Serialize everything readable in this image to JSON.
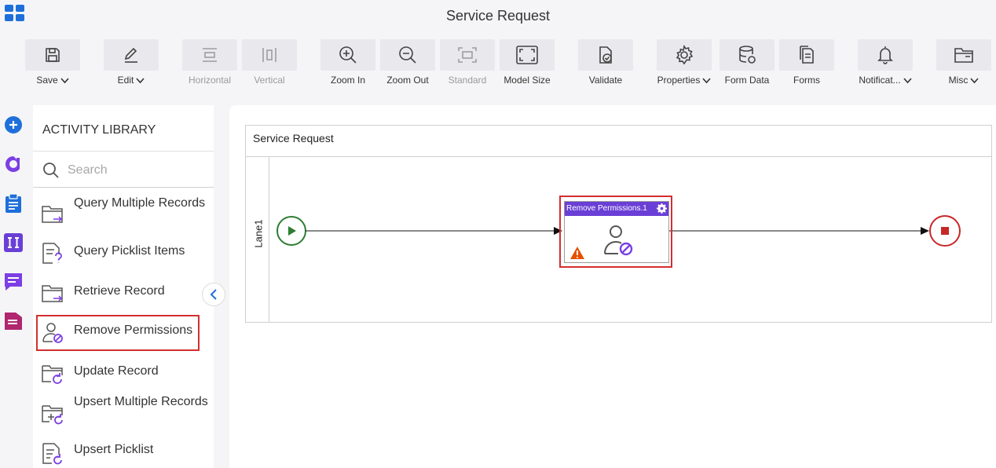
{
  "app": {
    "title": "Service Request"
  },
  "toolbar": {
    "items": [
      {
        "label": "Save",
        "icon": "save-icon",
        "dropdown": true,
        "enabled": true
      },
      {
        "label": "Edit",
        "icon": "pencil-icon",
        "dropdown": true,
        "enabled": true
      },
      {
        "label": "Horizontal",
        "icon": "horizontal-align-icon",
        "dropdown": false,
        "enabled": false
      },
      {
        "label": "Vertical",
        "icon": "vertical-align-icon",
        "dropdown": false,
        "enabled": false
      },
      {
        "label": "Zoom In",
        "icon": "zoom-in-icon",
        "dropdown": false,
        "enabled": true
      },
      {
        "label": "Zoom Out",
        "icon": "zoom-out-icon",
        "dropdown": false,
        "enabled": true
      },
      {
        "label": "Standard",
        "icon": "standard-size-icon",
        "dropdown": false,
        "enabled": false
      },
      {
        "label": "Model Size",
        "icon": "model-size-icon",
        "dropdown": false,
        "enabled": true
      },
      {
        "label": "Validate",
        "icon": "validate-icon",
        "dropdown": false,
        "enabled": true
      },
      {
        "label": "Properties",
        "icon": "gear-icon",
        "dropdown": true,
        "enabled": true
      },
      {
        "label": "Form Data",
        "icon": "database-icon",
        "dropdown": false,
        "enabled": true
      },
      {
        "label": "Forms",
        "icon": "forms-icon",
        "dropdown": false,
        "enabled": true
      },
      {
        "label": "Notificat...",
        "icon": "bell-icon",
        "dropdown": true,
        "enabled": true
      },
      {
        "label": "Misc",
        "icon": "folder-icon",
        "dropdown": true,
        "enabled": true
      }
    ]
  },
  "library": {
    "title": "ACTIVITY LIBRARY",
    "search_placeholder": "Search",
    "items": [
      {
        "label": "Query Multiple Records",
        "icon": "folder-arrow-icon",
        "selected": false
      },
      {
        "label": "Query Picklist Items",
        "icon": "document-question-icon",
        "selected": false
      },
      {
        "label": "Retrieve Record",
        "icon": "folder-arrow-icon",
        "selected": false
      },
      {
        "label": "Remove Permissions",
        "icon": "user-block-icon",
        "selected": true
      },
      {
        "label": "Update Record",
        "icon": "folder-refresh-icon",
        "selected": false
      },
      {
        "label": "Upsert Multiple Records",
        "icon": "folder-plus-refresh-icon",
        "selected": false
      },
      {
        "label": "Upsert Picklist",
        "icon": "document-refresh-icon",
        "selected": false
      }
    ]
  },
  "canvas": {
    "pool_title": "Service Request",
    "lane_label": "Lane1",
    "task_title": "Remove Permissions.1"
  },
  "colors": {
    "accent_purple": "#6a3fd6",
    "start_green": "#2e7d32",
    "end_red": "#c62828",
    "selection_red": "#d32f2f",
    "warning_orange": "#e65100"
  }
}
